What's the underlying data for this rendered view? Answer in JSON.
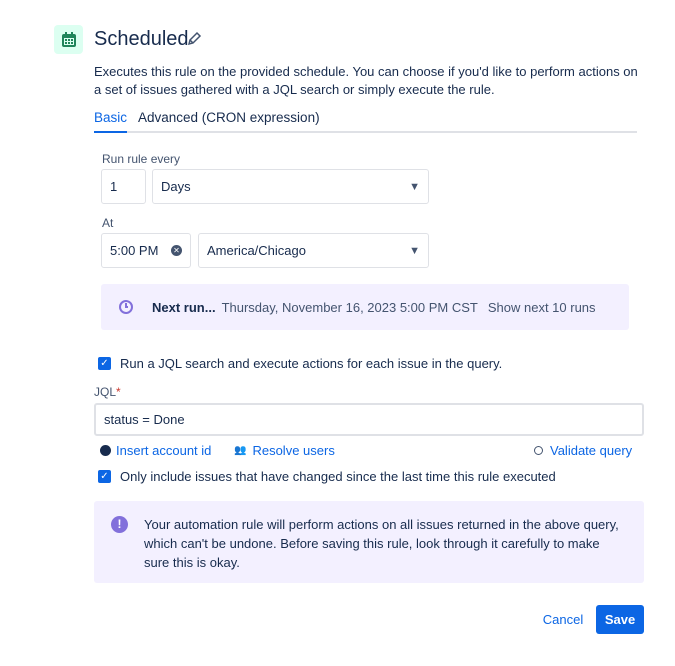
{
  "header": {
    "title": "Scheduled",
    "description": "Executes this rule on the provided schedule. You can choose if you'd like to perform actions on a set of issues gathered with a JQL search or simply execute the rule."
  },
  "tabs": [
    {
      "label": "Basic",
      "active": true
    },
    {
      "label": "Advanced (CRON expression)",
      "active": false
    }
  ],
  "schedule": {
    "run_every_label": "Run rule every",
    "interval_value": "1",
    "interval_unit": "Days",
    "at_label": "At",
    "time_value": "5:00 PM",
    "timezone": "America/Chicago"
  },
  "next_run": {
    "label": "Next run...",
    "value": "Thursday, November 16, 2023 5:00 PM CST",
    "show_more": "Show next 10 runs"
  },
  "jql": {
    "checkbox_label": "Run a JQL search and execute actions for each issue in the query.",
    "checked": true,
    "label": "JQL",
    "required": "*",
    "value": "status = Done",
    "insert_account": "Insert account id",
    "resolve_users": "Resolve users",
    "validate": "Validate query",
    "only_changed_label": "Only include issues that have changed since the last time this rule executed",
    "only_changed_checked": true
  },
  "warning": {
    "text": "Your automation rule will perform actions on all issues returned in the above query, which can't be undone. Before saving this rule, look through it carefully to make sure this is okay."
  },
  "footer": {
    "cancel": "Cancel",
    "save": "Save"
  },
  "colors": {
    "primary": "#0c66e4",
    "banner": "#f3f0ff",
    "icon_purple": "#8270db"
  }
}
